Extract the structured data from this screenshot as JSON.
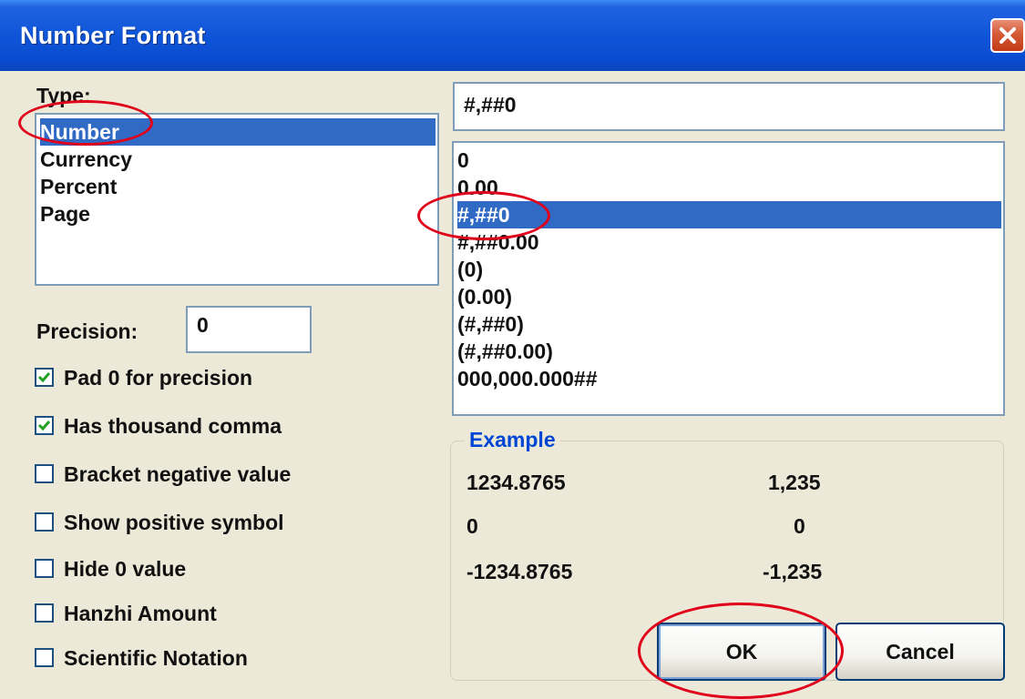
{
  "window": {
    "title": "Number Format"
  },
  "type_section": {
    "label": "Type:",
    "items": [
      "Number",
      "Currency",
      "Percent",
      "Page"
    ],
    "selected": "Number"
  },
  "precision": {
    "label": "Precision:",
    "value": "0"
  },
  "options": [
    {
      "label": "Pad 0 for precision",
      "checked": true
    },
    {
      "label": "Has thousand comma",
      "checked": true
    },
    {
      "label": "Bracket negative value",
      "checked": false
    },
    {
      "label": "Show positive symbol",
      "checked": false
    },
    {
      "label": "Hide 0 value",
      "checked": false
    },
    {
      "label": "Hanzhi Amount",
      "checked": false
    },
    {
      "label": "Scientific Notation",
      "checked": false
    }
  ],
  "format": {
    "value": "#,##0",
    "items": [
      "0",
      "0.00",
      "#,##0",
      "#,##0.00",
      "(0)",
      "(0.00)",
      "(#,##0)",
      "(#,##0.00)",
      "000,000.000##"
    ],
    "selected": "#,##0"
  },
  "example": {
    "title": "Example",
    "rows": [
      {
        "input": "1234.8765",
        "output": "1,235"
      },
      {
        "input": "0",
        "output": "0"
      },
      {
        "input": "-1234.8765",
        "output": "-1,235"
      }
    ]
  },
  "buttons": {
    "ok": "OK",
    "cancel": "Cancel"
  },
  "colors": {
    "selection": "#316ac5",
    "annotation": "#e0001a",
    "titlebar": "#0a4bd0"
  }
}
